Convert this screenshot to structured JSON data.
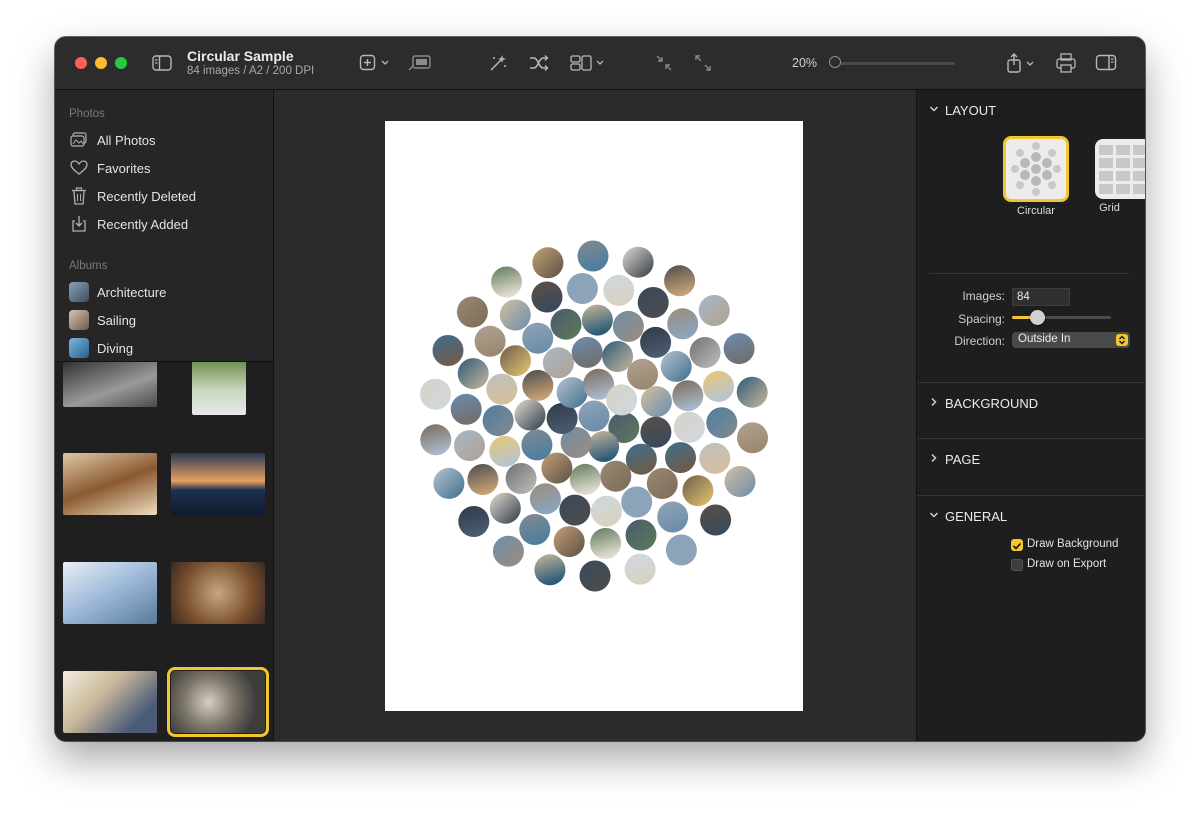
{
  "window": {
    "title": "Circular Sample",
    "subtitle": "84 images / A2 / 200 DPI"
  },
  "toolbar": {
    "icons": [
      "sidebar-toggle-icon",
      "add-icon",
      "chevron-down-icon",
      "slideshow-icon",
      "magic-wand-icon",
      "shuffle-icon",
      "layout-icon",
      "collapse-icon",
      "expand-icon",
      "share-icon",
      "print-icon",
      "inspector-toggle-icon"
    ],
    "zoom_label": "20%",
    "zoom_fraction": 0.0
  },
  "sidebar": {
    "photos_header": "Photos",
    "photos": [
      {
        "label": "All Photos",
        "icon": "photos-icon"
      },
      {
        "label": "Favorites",
        "icon": "heart-icon"
      },
      {
        "label": "Recently Deleted",
        "icon": "trash-icon"
      },
      {
        "label": "Recently Added",
        "icon": "import-icon"
      }
    ],
    "albums_header": "Albums",
    "albums": [
      {
        "label": "Architecture",
        "color": "#5a6e86"
      },
      {
        "label": "Sailing",
        "color": "#7b6a55"
      },
      {
        "label": "Diving",
        "color": "#3d7fa8"
      }
    ],
    "thumbnails": [
      {
        "colors": [
          "#3a3a3a",
          "#a8a8a8"
        ]
      },
      {
        "colors": [
          "#6c8c4a",
          "#e8e8e8"
        ]
      },
      {
        "colors": [
          "#a06f3c",
          "#f0ddc0"
        ]
      },
      {
        "colors": [
          "#1e3050",
          "#e8a060"
        ]
      },
      {
        "colors": [
          "#9cb8d8",
          "#f4f4f4"
        ]
      },
      {
        "colors": [
          "#7a5030",
          "#c8a880"
        ]
      },
      {
        "colors": [
          "#c8b89a",
          "#4a5a78"
        ]
      },
      {
        "colors": [
          "#3c3c3c",
          "#d4cfc0"
        ]
      }
    ],
    "selected_thumbnail": 7
  },
  "canvas": {
    "circle_colors": [
      "#8fa3b8",
      "#4a5a6e",
      "#c9b89a",
      "#6e8fa8",
      "#2e3a48",
      "#b7c4cf",
      "#7a6a58",
      "#d8d2c4",
      "#3e6e8e",
      "#9a8a72",
      "#5e7a5a",
      "#c4a074",
      "#828a92",
      "#e2dcd0",
      "#4c4c4c",
      "#a8b8c8",
      "#6a8cae",
      "#2c5a7a",
      "#b0a090",
      "#d4c0a0",
      "#5a5046",
      "#8aa4bc",
      "#cfd8e0",
      "#3a4a5a",
      "#9c8c7c",
      "#707070",
      "#e8c870",
      "#4e7e9e",
      "#bfbfbf",
      "#6c5c4c"
    ],
    "circle_count": 84
  },
  "inspector": {
    "layout_header": "LAYOUT",
    "layout_options": [
      {
        "label": "Circular",
        "selected": true
      },
      {
        "label": "Grid",
        "selected": false
      }
    ],
    "images_label": "Images:",
    "images_value": "84",
    "spacing_label": "Spacing:",
    "spacing_fraction": 0.25,
    "direction_label": "Direction:",
    "direction_value": "Outside In",
    "background_header": "BACKGROUND",
    "page_header": "PAGE",
    "general_header": "GENERAL",
    "draw_background_label": "Draw Background",
    "draw_background_checked": true,
    "draw_on_export_label": "Draw on Export",
    "draw_on_export_checked": false,
    "accent_color": "#f2c62f"
  }
}
